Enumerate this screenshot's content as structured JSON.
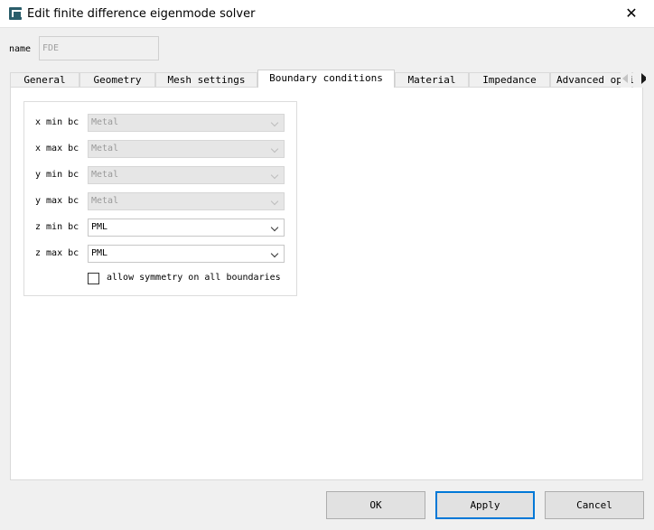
{
  "window": {
    "title": "Edit finite difference eigenmode solver",
    "close_glyph": "✕"
  },
  "name_field": {
    "label": "name",
    "value": "FDE"
  },
  "tabs": [
    {
      "label": "General"
    },
    {
      "label": "Geometry"
    },
    {
      "label": "Mesh settings"
    },
    {
      "label": "Boundary conditions",
      "active": true
    },
    {
      "label": "Material"
    },
    {
      "label": "Impedance"
    },
    {
      "label": "Advanced options"
    }
  ],
  "boundary": {
    "rows": [
      {
        "label": "x min bc",
        "value": "Metal",
        "enabled": false
      },
      {
        "label": "x max bc",
        "value": "Metal",
        "enabled": false
      },
      {
        "label": "y min bc",
        "value": "Metal",
        "enabled": false
      },
      {
        "label": "y max bc",
        "value": "Metal",
        "enabled": false
      },
      {
        "label": "z min bc",
        "value": "PML",
        "enabled": true
      },
      {
        "label": "z max bc",
        "value": "PML",
        "enabled": true
      }
    ],
    "symmetry_checkbox": {
      "label": "allow symmetry on all boundaries",
      "checked": false
    }
  },
  "buttons": {
    "ok": "OK",
    "apply": "Apply",
    "cancel": "Cancel"
  }
}
